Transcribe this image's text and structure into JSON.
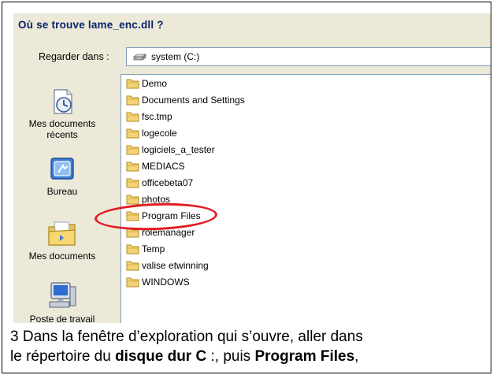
{
  "dialog": {
    "title": "Où se trouve  lame_enc.dll ?",
    "lookin_label": "Regarder dans :",
    "lookin_value": "system (C:)"
  },
  "places": [
    {
      "label": "Mes documents récents",
      "icon": "recent-documents-icon"
    },
    {
      "label": "Bureau",
      "icon": "desktop-icon"
    },
    {
      "label": "Mes documents",
      "icon": "my-documents-icon"
    },
    {
      "label": "Poste de travail",
      "icon": "my-computer-icon"
    }
  ],
  "files": [
    "Demo",
    "Documents and Settings",
    "fsc.tmp",
    "logecole",
    "logiciels_a_tester",
    "MEDIACS",
    "officebeta07",
    "photos",
    "Program Files",
    "rolemanager",
    "Temp",
    "valise etwinning",
    "WINDOWS"
  ],
  "highlighted_file": "Program Files",
  "caption": {
    "line1": "3 Dans la fenêtre d’exploration qui s’ouvre, aller dans",
    "part1": "le répertoire du ",
    "bold1": "disque dur C",
    "part2": " :, puis ",
    "bold2": "Program Files",
    "part3": ","
  },
  "colors": {
    "dialog_bg": "#ece9d8",
    "title_text": "#0a246a",
    "highlight": "#e31b23",
    "folder": "#f3d37a"
  }
}
